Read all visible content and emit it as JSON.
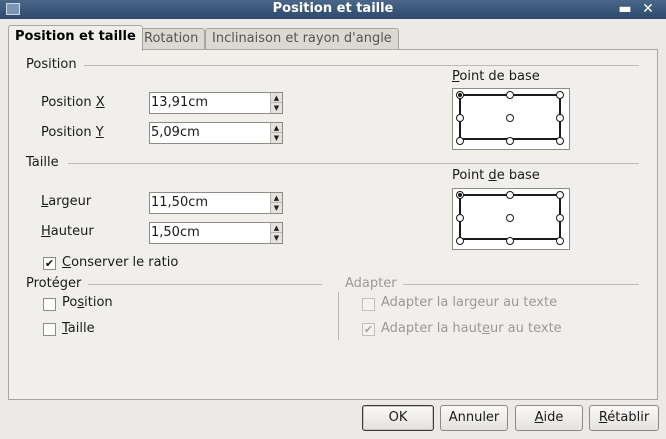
{
  "window": {
    "title": "Position et taille",
    "minimize_glyph": "▬",
    "close_glyph": "✕"
  },
  "tabs": [
    {
      "label": "Position et taille",
      "active": true
    },
    {
      "label": "Rotation",
      "active": false
    },
    {
      "label": "Inclinaison et rayon d'angle",
      "active": false
    }
  ],
  "position_section": {
    "title": "Position",
    "x_label_prefix": "Position ",
    "x_label_key": "X",
    "x_value": "13,91cm",
    "y_label_prefix": "Position ",
    "y_label_key": "Y",
    "y_value": "5,09cm",
    "base_point_label_key": "P",
    "base_point_label_rest": "oint de base"
  },
  "size_section": {
    "title": "Taille",
    "width_label_key": "L",
    "width_label_rest": "argeur",
    "width_value": "11,50cm",
    "height_label_key": "H",
    "height_label_rest": "auteur",
    "height_value": "1,50cm",
    "keep_ratio_key": "C",
    "keep_ratio_rest": "onserver le ratio",
    "keep_ratio_checked": "✔",
    "base_point_label_pre": "Point ",
    "base_point_label_key": "d",
    "base_point_label_rest": "e base"
  },
  "protect_section": {
    "title": "Protéger",
    "position_pre": "Po",
    "position_key": "s",
    "position_rest": "ition",
    "size_key": "T",
    "size_rest": "aille"
  },
  "adapt_section": {
    "title": "Adapter",
    "fit_width_label": "Adapter la largeur au texte",
    "fit_height_pre": "Adapter la haut",
    "fit_height_key": "e",
    "fit_height_rest": "ur au texte",
    "fit_height_checked": "✔"
  },
  "buttons": {
    "ok": "OK",
    "cancel": "Annuler",
    "help_key": "A",
    "help_rest": "ide",
    "reset_key": "R",
    "reset_rest": "établir"
  },
  "spin_glyphs": {
    "up": "▲",
    "down": "▼"
  }
}
